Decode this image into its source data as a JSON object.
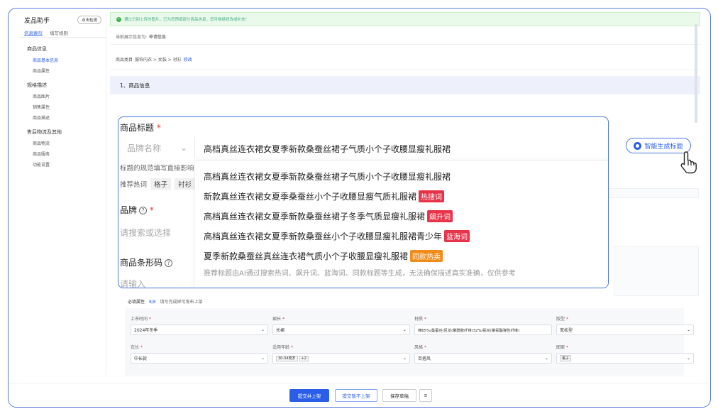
{
  "notice": "通过识别上传的图片，已为您预填部分商品信息，您可继续修改或补充！",
  "sidebar": {
    "title": "发品助手",
    "button": "点击检测",
    "tabs": [
      "信息索引",
      "填写规则"
    ],
    "groups": [
      {
        "label": "商品信息",
        "items": [
          "商品基本信息",
          "商品属性"
        ]
      },
      {
        "label": "规格描述",
        "items": [
          "商品图片",
          "销售属性",
          "商品描述"
        ]
      },
      {
        "label": "售后物流及其他",
        "items": [
          "商品物流",
          "商品服务",
          "功能设置"
        ]
      }
    ]
  },
  "current_info": {
    "label": "当前展示信息为:",
    "value": "申请信息"
  },
  "category": {
    "label": "商品类目",
    "path": "服饰内衣 > 女装 > 衬衫",
    "edit": "修改"
  },
  "section_title": "1、商品信息",
  "popup": {
    "title_label": "商品标题",
    "brand_select_placeholder": "品牌名称",
    "title_value": "高档真丝连衣裙女夏季新款桑蚕丝裙子气质小个子收腰显瘦礼服裙",
    "title_hint": "标题的规范填写直接影响",
    "hot_words_label": "推荐热词",
    "hot_words": [
      "格子",
      "衬衫"
    ],
    "brand_label": "品牌",
    "brand_placeholder": "请搜索或选择",
    "barcode_label": "商品条形码",
    "barcode_placeholder": "请输入",
    "options": [
      {
        "text": "高档真丝连衣裙女夏季新款桑蚕丝裙子气质小个子收腰显瘦礼服裙",
        "badge": ""
      },
      {
        "text": "新款真丝连衣裙女夏季桑蚕丝小个子收腰显瘦气质礼服裙",
        "badge": "热搜词"
      },
      {
        "text": "高档真丝连衣裙女夏季新款桑蚕丝裙子冬季气质显瘦礼服裙",
        "badge": "飙升词"
      },
      {
        "text": "高档真丝连衣裙女夏季新款桑蚕丝小个子收腰显瘦礼服裙青少年",
        "badge": "蓝海词"
      },
      {
        "text": "夏季新款桑蚕丝真丝连衣裙气质小个子收腰显瘦礼服裙",
        "badge": "同款热卖"
      }
    ],
    "note": "推荐标题由AI通过搜索热词、飙升词、蓝海词、同款标题等生成，无法确保描述真实准确，仅供参考"
  },
  "ai_button": "智能生成标题",
  "attributes": {
    "title": "必填属性",
    "count": "8/8",
    "hint": "填写完成即可发布上架",
    "fields": [
      {
        "label": "上市时间",
        "value": "2024年冬季"
      },
      {
        "label": "裙长",
        "value": "长裙"
      },
      {
        "label": "材质",
        "value": "棉65%/桑蚕丝/尼龙(聚酰胺纤维)32%/氨纶(聚氨酯弹性纤维)"
      },
      {
        "label": "版型",
        "value": "宽松型"
      },
      {
        "label": "衣长",
        "value": "中长款"
      },
      {
        "label": "适用年龄",
        "value": "30-34周岁",
        "extra": "+2"
      },
      {
        "label": "风格",
        "value": "百搭风"
      },
      {
        "label": "图案",
        "value": "格子"
      }
    ]
  },
  "footer": {
    "submit": "提交并上架",
    "submit_off": "提交暂不上架",
    "draft": "保存草稿",
    "menu_icon": "≡"
  },
  "colors": {
    "accent": "#2b5ee8",
    "badge_hot": "#e8334a",
    "badge_same": "#f08c1a"
  }
}
